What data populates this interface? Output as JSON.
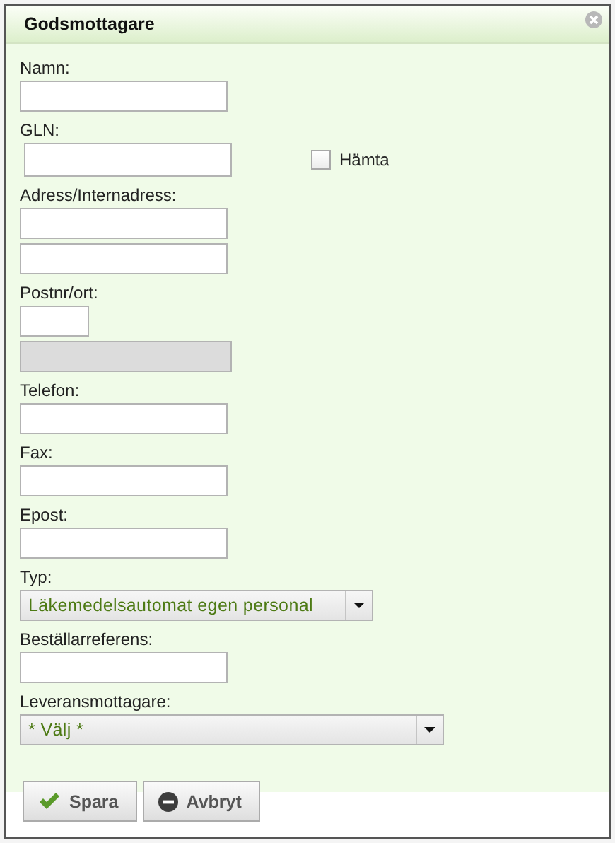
{
  "dialog": {
    "title": "Godsmottagare"
  },
  "fields": [
    {
      "kind": "text",
      "label": "Namn:"
    },
    {
      "kind": "text",
      "label": "GLN:",
      "checkbox": {
        "label": "Hämta",
        "checked": false
      }
    },
    {
      "kind": "double",
      "label": "Adress/Internadress:"
    },
    {
      "kind": "postal",
      "label": "Postnr/ort:"
    },
    {
      "kind": "text",
      "label": "Telefon:"
    },
    {
      "kind": "text",
      "label": "Fax:"
    },
    {
      "kind": "text",
      "label": "Epost:"
    },
    {
      "kind": "select",
      "label": "Typ:",
      "value": "Läkemedelsautomat egen personal"
    },
    {
      "kind": "text",
      "label": "Beställarreferens:"
    },
    {
      "kind": "select-wide",
      "label": "Leveransmottagare:",
      "value": "* Välj *"
    }
  ],
  "buttons": [
    {
      "label": "Spara",
      "kind": "save"
    },
    {
      "label": "Avbryt",
      "kind": "cancel"
    }
  ]
}
